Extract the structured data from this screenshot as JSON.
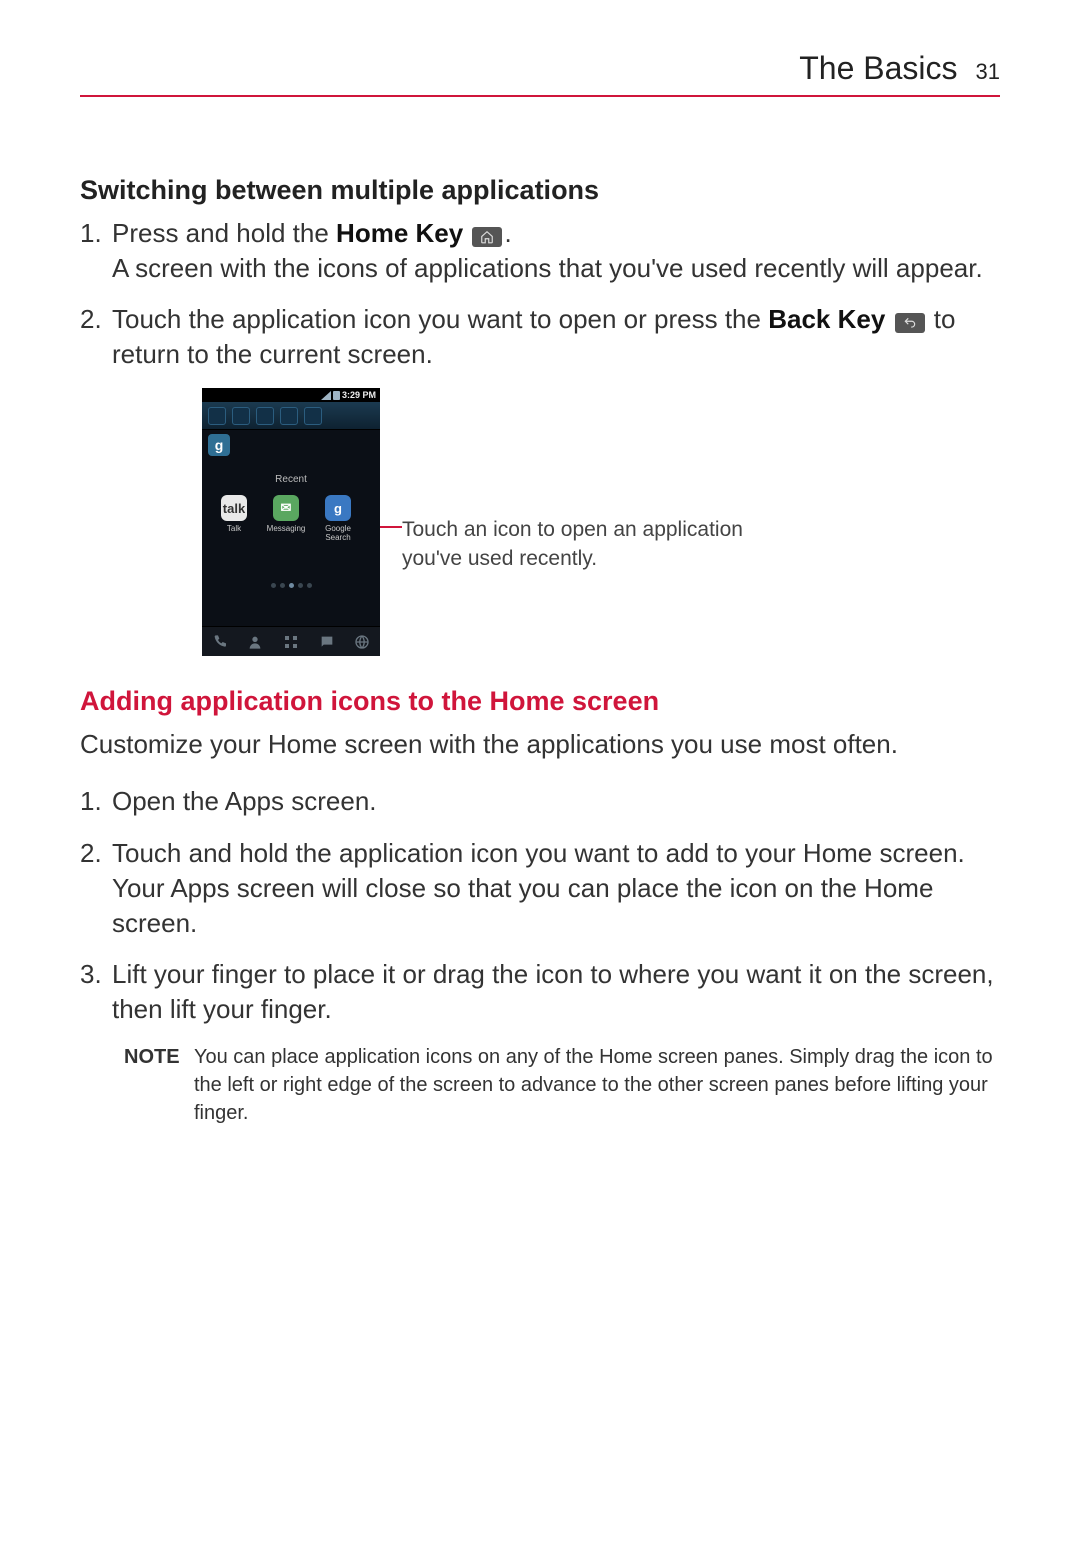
{
  "header": {
    "title": "The Basics",
    "page_number": "31"
  },
  "section1": {
    "heading": "Switching between multiple applications",
    "step1_a": "Press and hold the ",
    "step1_b": "Home Key",
    "step1_c": ".",
    "step1_line2": "A screen with the icons of applications that you've used recently will appear.",
    "step2_a": "Touch the application icon you want to open or press the ",
    "step2_b": "Back Key",
    "step2_c": " to return to the current screen."
  },
  "screenshot": {
    "time": "3:29 PM",
    "recent_label": "Recent",
    "apps": [
      {
        "name": "talk",
        "label": "Talk"
      },
      {
        "name": "messaging",
        "label": "Messaging"
      },
      {
        "name": "google-search",
        "label": "Google\nSearch"
      }
    ]
  },
  "callout": {
    "line1": "Touch an icon to open an application you've used recently."
  },
  "section2": {
    "heading": "Adding application icons to the Home screen",
    "intro": "Customize your Home screen with the applications you use most often.",
    "step1": "Open the Apps screen.",
    "step2": "Touch and hold the application icon you want to add to your Home screen. Your Apps screen will close so that you can place the icon on the Home screen.",
    "step3": "Lift your finger to place it or drag the icon to where you want it on the screen, then lift your finger."
  },
  "note": {
    "label": "NOTE",
    "text": "You can place application icons on any of the Home screen panes.  Simply drag the icon to the left or right edge of the screen to advance to the other screen panes before lifting your finger."
  }
}
